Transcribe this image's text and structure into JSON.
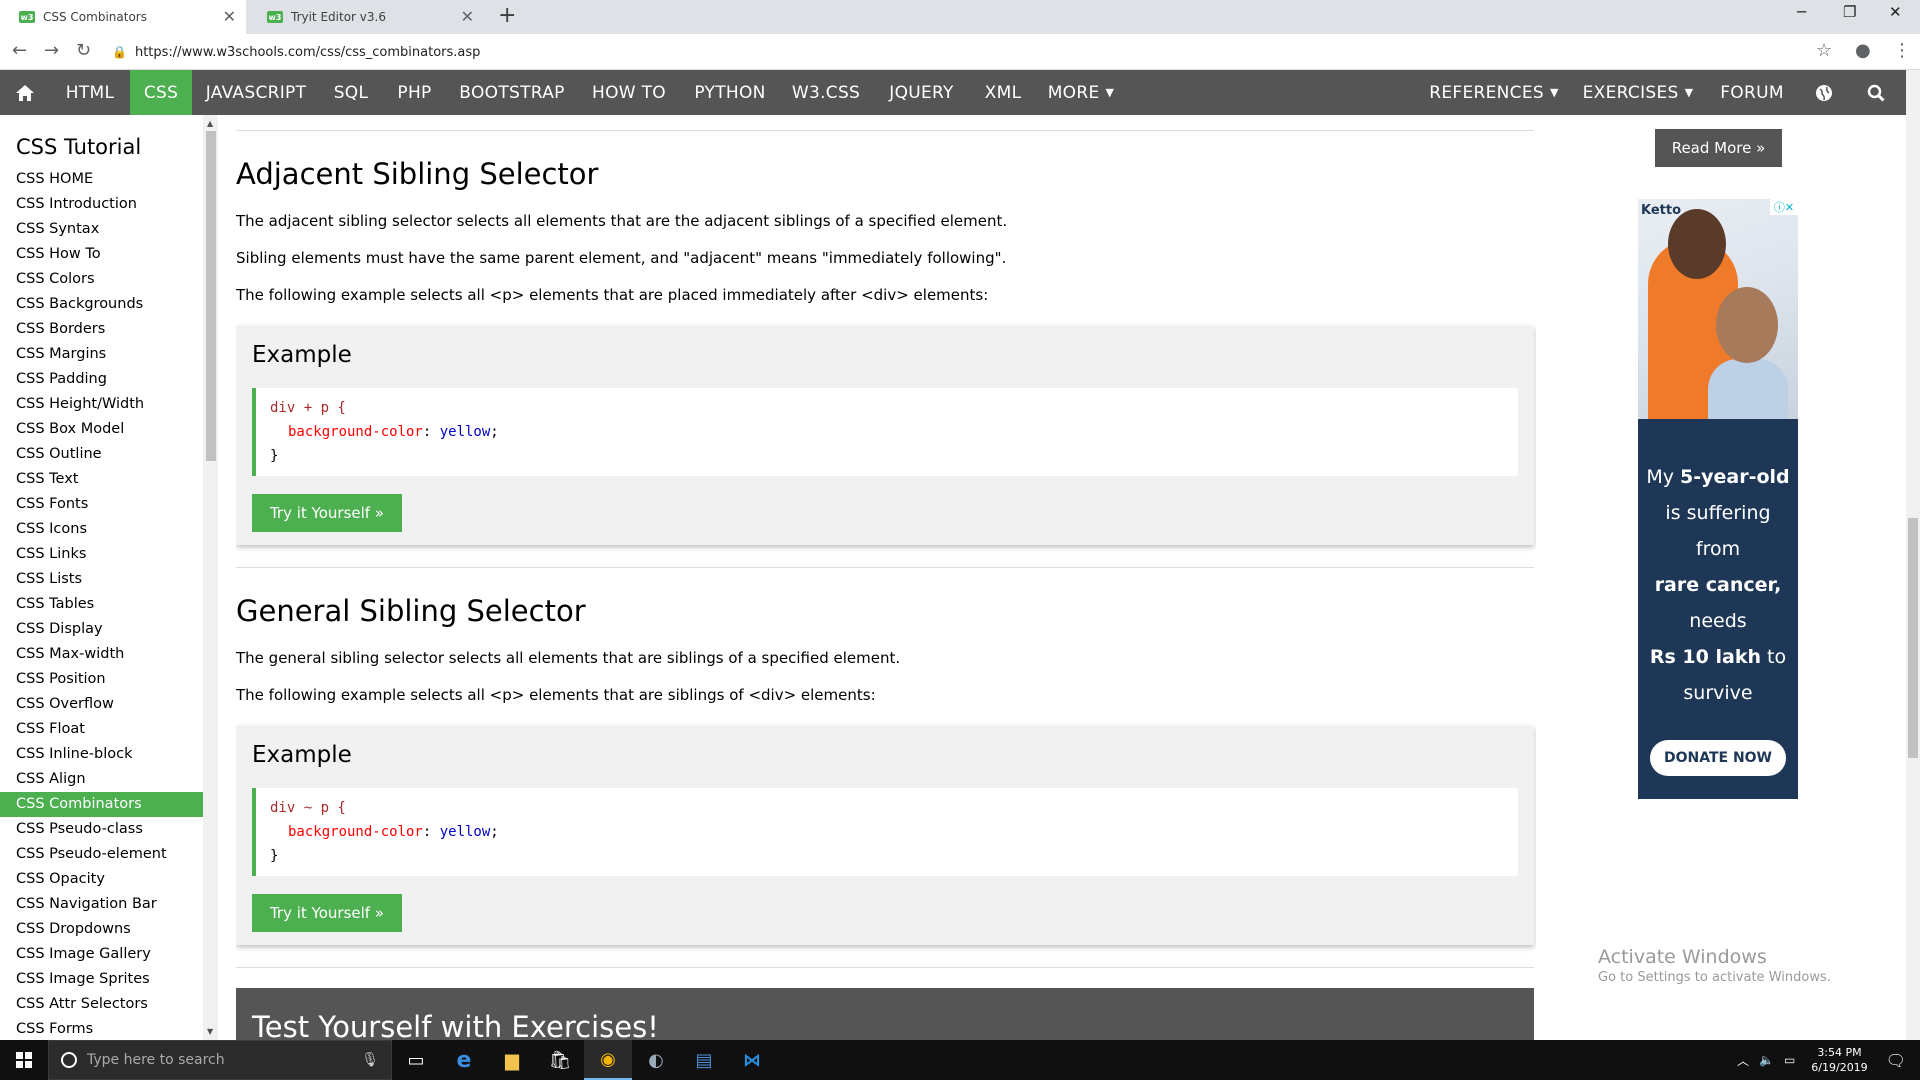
{
  "browser": {
    "tabs": [
      {
        "title": "CSS Combinators",
        "favicon": "w3"
      },
      {
        "title": "Tryit Editor v3.6",
        "favicon": "w3"
      }
    ],
    "url": "https://www.w3schools.com/css/css_combinators.asp"
  },
  "topnav": {
    "items": [
      "HTML",
      "CSS",
      "JAVASCRIPT",
      "SQL",
      "PHP",
      "BOOTSTRAP",
      "HOW TO",
      "PYTHON",
      "W3.CSS",
      "JQUERY",
      "XML",
      "MORE"
    ],
    "active": "CSS",
    "right_items": [
      "REFERENCES",
      "EXERCISES",
      "FORUM"
    ]
  },
  "sidebar": {
    "title": "CSS Tutorial",
    "items": [
      "CSS HOME",
      "CSS Introduction",
      "CSS Syntax",
      "CSS How To",
      "CSS Colors",
      "CSS Backgrounds",
      "CSS Borders",
      "CSS Margins",
      "CSS Padding",
      "CSS Height/Width",
      "CSS Box Model",
      "CSS Outline",
      "CSS Text",
      "CSS Fonts",
      "CSS Icons",
      "CSS Links",
      "CSS Lists",
      "CSS Tables",
      "CSS Display",
      "CSS Max-width",
      "CSS Position",
      "CSS Overflow",
      "CSS Float",
      "CSS Inline-block",
      "CSS Align",
      "CSS Combinators",
      "CSS Pseudo-class",
      "CSS Pseudo-element",
      "CSS Opacity",
      "CSS Navigation Bar",
      "CSS Dropdowns",
      "CSS Image Gallery",
      "CSS Image Sprites",
      "CSS Attr Selectors",
      "CSS Forms"
    ],
    "active": "CSS Combinators"
  },
  "main": {
    "adjacent": {
      "heading": "Adjacent Sibling Selector",
      "paragraphs": [
        "The adjacent sibling selector selects all elements that are the adjacent siblings of a specified element.",
        "Sibling elements must have the same parent element, and \"adjacent\" means \"immediately following\".",
        "The following example selects all <p> elements that are placed immediately after <div> elements:"
      ],
      "example_title": "Example",
      "code": {
        "selector": "div + p {",
        "property": "background-color",
        "value": "yellow",
        "close": "}"
      },
      "button": "Try it Yourself »"
    },
    "general": {
      "heading": "General Sibling Selector",
      "paragraphs": [
        "The general sibling selector selects all elements that are siblings of a specified element.",
        "The following example selects all <p> elements that are siblings of <div> elements:"
      ],
      "example_title": "Example",
      "code": {
        "selector": "div ~ p {",
        "property": "background-color",
        "value": "yellow",
        "close": "}"
      },
      "button": "Try it Yourself »"
    },
    "exercise_banner": "Test Yourself with Exercises!"
  },
  "right": {
    "read_more": "Read More »",
    "ad": {
      "brand": "Ketto",
      "lines": [
        "My ",
        "5-year-old",
        "is suffering",
        "from",
        "rare cancer,",
        "needs",
        "Rs 10 lakh",
        " to",
        "survive"
      ],
      "donate": "DONATE NOW"
    }
  },
  "watermark": {
    "title": "Activate Windows",
    "subtitle": "Go to Settings to activate Windows."
  },
  "taskbar": {
    "search_placeholder": "Type here to search",
    "time": "3:54 PM",
    "date": "6/19/2019"
  }
}
